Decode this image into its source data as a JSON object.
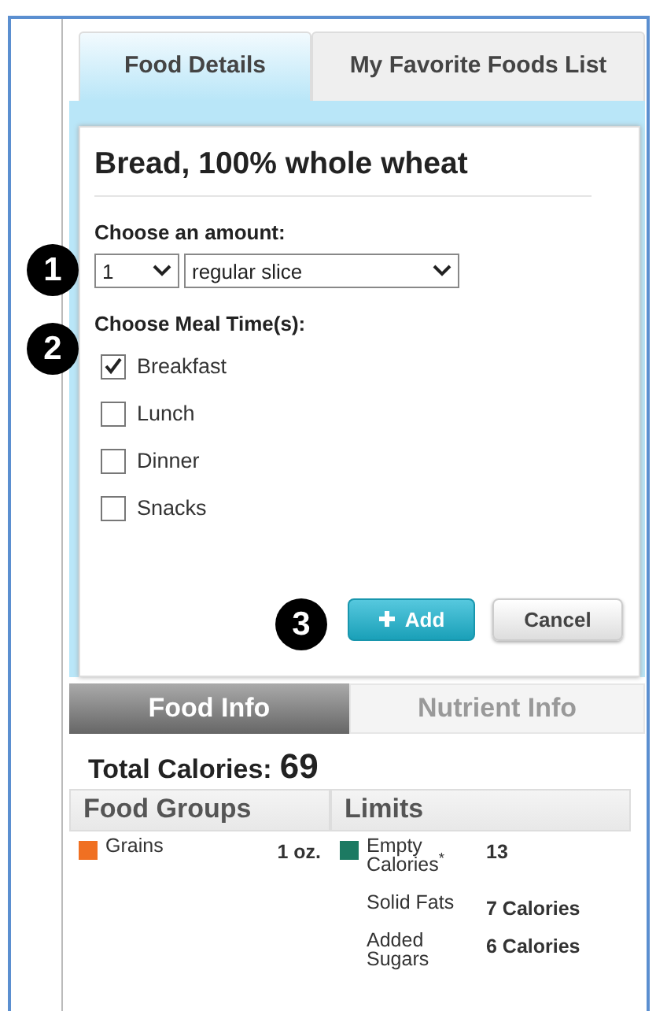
{
  "tabs": [
    {
      "label": "Food Details",
      "selected": true
    },
    {
      "label": "My Favorite Foods List",
      "selected": false
    }
  ],
  "food": {
    "name": "Bread, 100% whole wheat"
  },
  "amount": {
    "label": "Choose an amount:",
    "quantity": "1",
    "unit": "regular slice"
  },
  "meal_times": {
    "label": "Choose Meal Time(s):",
    "options": [
      {
        "label": "Breakfast",
        "checked": true
      },
      {
        "label": "Lunch",
        "checked": false
      },
      {
        "label": "Dinner",
        "checked": false
      },
      {
        "label": "Snacks",
        "checked": false
      }
    ]
  },
  "buttons": [
    {
      "label": "Add",
      "kind": "primary"
    },
    {
      "label": "Cancel",
      "kind": "secondary"
    }
  ],
  "callouts": [
    "1",
    "2",
    "3"
  ],
  "info_tabs": [
    {
      "label": "Food Info",
      "selected": true
    },
    {
      "label": "Nutrient Info",
      "selected": false
    }
  ],
  "total_calories": {
    "label": "Total Calories:",
    "value": "69"
  },
  "food_groups": {
    "title": "Food Groups",
    "rows": [
      {
        "name": "Grains",
        "amount": "1 oz.",
        "color": "#f07022"
      }
    ]
  },
  "limits": {
    "title": "Limits",
    "rows": [
      {
        "name": "Empty Calories$^{*}$",
        "amount": "13",
        "color": "#1c7a62"
      },
      {
        "name": "Solid Fats",
        "amount": "7 Calories"
      },
      {
        "name": "Added Sugars",
        "amount": "6 Calories"
      }
    ]
  }
}
